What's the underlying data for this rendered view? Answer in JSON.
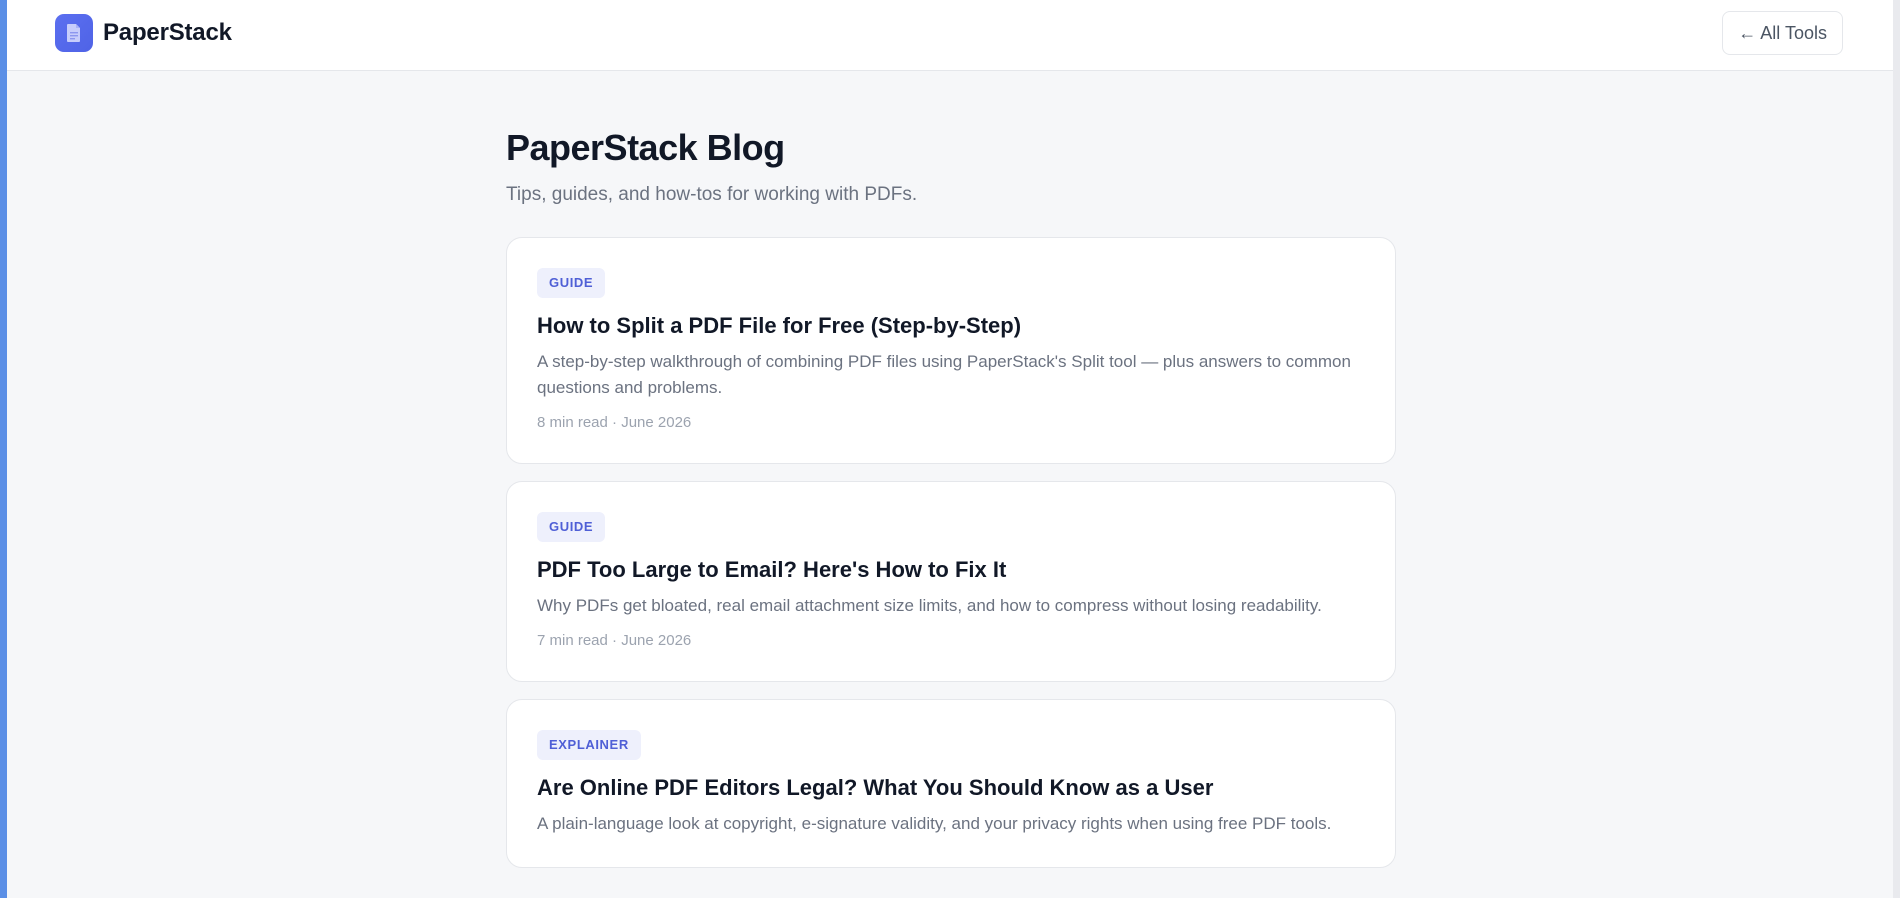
{
  "header": {
    "brand_name": "PaperStack",
    "logo_icon": "document-icon",
    "all_tools_label": "← All Tools"
  },
  "main": {
    "title": "PaperStack Blog",
    "subtitle": "Tips, guides, and how-tos for working with PDFs."
  },
  "posts": [
    {
      "tag": "GUIDE",
      "title": "How to Split a PDF File for Free (Step-by-Step)",
      "excerpt": "A step-by-step walkthrough of combining PDF files using PaperStack's Split tool — plus answers to common questions and problems.",
      "meta": "8 min read · June 2026"
    },
    {
      "tag": "GUIDE",
      "title": "PDF Too Large to Email? Here's How to Fix It",
      "excerpt": "Why PDFs get bloated, real email attachment size limits, and how to compress without losing readability.",
      "meta": "7 min read · June 2026"
    },
    {
      "tag": "EXPLAINER",
      "title": "Are Online PDF Editors Legal? What You Should Know as a User",
      "excerpt": "A plain-language look at copyright, e-signature validity, and your privacy rights when using free PDF tools.",
      "meta": ""
    }
  ],
  "colors": {
    "accent": "#5b6ff0",
    "tag_background": "#eef0fc",
    "tag_text": "#4f5fd6",
    "page_background": "#f6f7f9"
  }
}
